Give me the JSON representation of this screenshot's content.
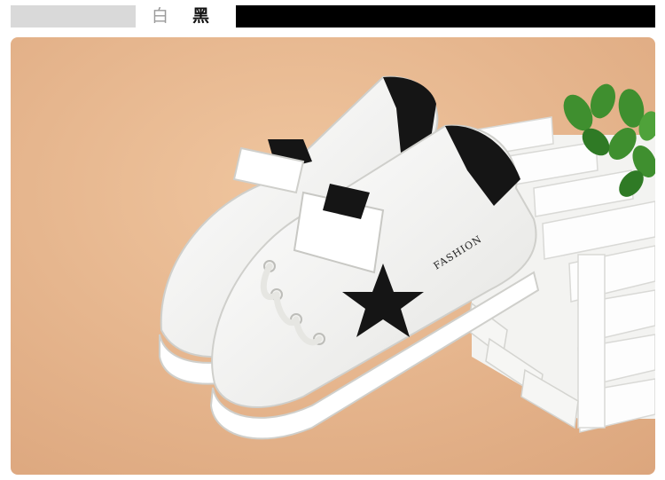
{
  "header": {
    "label_white": "白",
    "label_black": "黑"
  },
  "photo": {
    "brand_text": "FASHION",
    "colors": {
      "background": "#e8b78e",
      "shoe_body": "#f7f7f5",
      "accent": "#151515",
      "crate": "#fafafa",
      "leaves": "#3f8f2f"
    },
    "icons": [
      "star-icon"
    ]
  }
}
